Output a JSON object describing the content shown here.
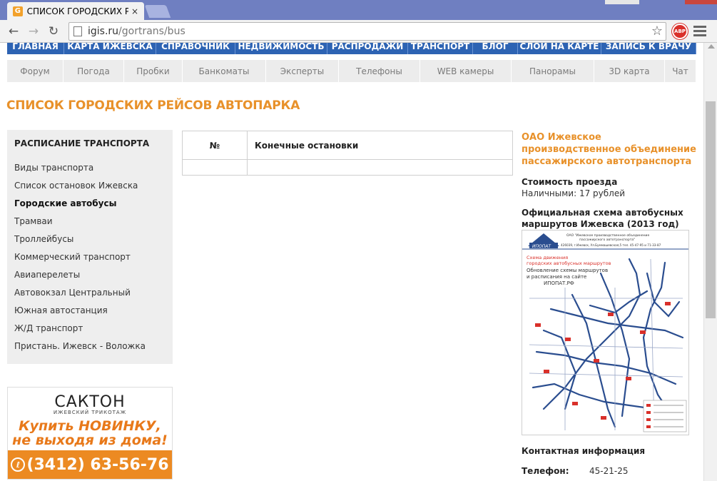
{
  "browser": {
    "tab_title": "СПИСОК ГОРОДСКИХ РЕ",
    "tab_close": "×",
    "url_host": "igis.ru",
    "url_path": "/gortrans/bus",
    "abp_label": "ABP"
  },
  "main_nav": [
    "ГЛАВНАЯ",
    "КАРТА ИЖЕВСКА",
    "СПРАВОЧНИК",
    "НЕДВИЖИМОСТЬ",
    "РАСПРОДАЖИ",
    "ТРАНСПОРТ",
    "БЛОГ",
    "СЛОИ НА КАРТЕ",
    "ЗАПИСЬ К ВРАЧУ"
  ],
  "sub_nav": [
    "Форум",
    "Погода",
    "Пробки",
    "Банкоматы",
    "Эксперты",
    "Телефоны",
    "WEB камеры",
    "Панорамы",
    "3D карта",
    "Чат"
  ],
  "page_title": "СПИСОК ГОРОДСКИХ РЕЙСОВ АВТОПАРКА",
  "sidebar": {
    "title": "РАСПИСАНИЕ ТРАНСПОРТА",
    "items": [
      {
        "label": "Виды транспорта",
        "active": false
      },
      {
        "label": "Список остановок Ижевска",
        "active": false
      },
      {
        "label": "Городские автобусы",
        "active": true
      },
      {
        "label": "Трамваи",
        "active": false
      },
      {
        "label": "Троллейбусы",
        "active": false
      },
      {
        "label": "Коммерческий транспорт",
        "active": false
      },
      {
        "label": "Авиаперелеты",
        "active": false
      },
      {
        "label": "Автовокзал Центральный",
        "active": false
      },
      {
        "label": "Южная автостанция",
        "active": false
      },
      {
        "label": "Ж/Д транспорт",
        "active": false
      },
      {
        "label": "Пристань. Ижевск - Воложка",
        "active": false
      }
    ]
  },
  "ad": {
    "brand": "САКТОН",
    "brand_sub": "ИЖЕВСКИЙ ТРИКОТАЖ",
    "slogan_line1": "Купить НОВИНКУ,",
    "slogan_line2": "не выходя из дома!",
    "phone": "(3412) 63-56-76",
    "phone_icon": "ℓ"
  },
  "table": {
    "col_num": "№",
    "col_stops": "Конечные остановки"
  },
  "right": {
    "org": "ОАО Ижевское производственное объединение пассажирского автотранспорта",
    "fare_label": "Стоимость проезда",
    "fare_value": "Наличными: 17 рублей",
    "scheme_label": "Официальная схема автобусных маршрутов Ижевска (2013 год)",
    "map": {
      "logo": "ИПОПАТ",
      "header1": "ОАО \"Ижевское производственное объединение",
      "header2": "пассажирского автотранспорта\"",
      "header3": "426039, г.Ижевск, Ул.Буммашевская,5 тел. 45-47-95 и 71-33-87",
      "red1": "Схема движения",
      "red2": "городских автобусных маршрутов",
      "note1": "Обновление схемы маршрутов",
      "note2": "и расписания на сайте",
      "note3": "ИПОПАТ.РФ"
    },
    "contact_title": "Контактная информация",
    "phone_label": "Телефон:",
    "phone_value": "45-21-25"
  },
  "colors": {
    "accent_orange": "#e8912a",
    "nav_blue": "#2d63b3",
    "map_route": "#2a4d8f",
    "map_red": "#d9302a"
  }
}
